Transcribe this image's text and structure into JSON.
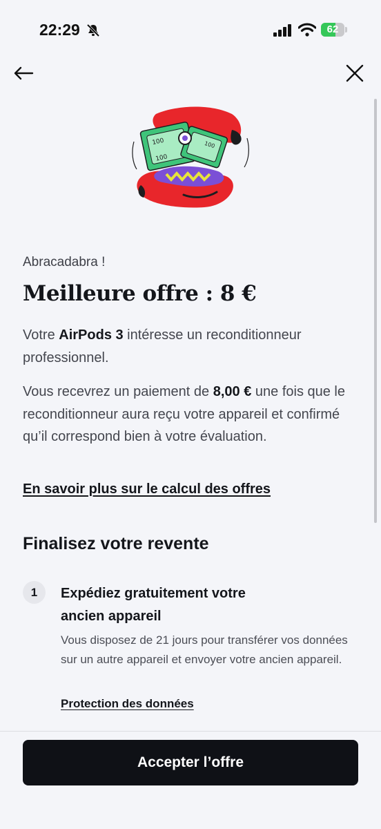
{
  "status_bar": {
    "time": "22:29",
    "battery_level": "62",
    "battery_fraction": 0.62,
    "icons": [
      "bell-slash-icon",
      "cellular-signal-icon",
      "wifi-icon",
      "battery-charging-icon"
    ]
  },
  "nav": {
    "back_icon": "arrow-left-icon",
    "close_icon": "close-icon"
  },
  "illustration": {
    "name": "hands-with-banknotes-illustration",
    "colors": {
      "red": "#e8262b",
      "green": "#3fc47a",
      "purple": "#7b4fd6",
      "yellow": "#e8e43a"
    }
  },
  "offer": {
    "kicker": "Abracadabra !",
    "title": "Meilleure offre : 8 €",
    "para1_prefix": "Votre ",
    "para1_product": "AirPods 3",
    "para1_suffix": " intéresse un reconditionneur professionnel.",
    "para2_prefix": "Vous recevrez un paiement de ",
    "para2_amount": "8,00 €",
    "para2_suffix": " une fois que le reconditionneur aura reçu votre appareil et confirmé qu’il correspond bien à votre évaluation.",
    "learn_more_link": "En savoir plus sur le calcul des offres"
  },
  "finalize": {
    "title": "Finalisez votre revente",
    "steps": [
      {
        "number": "1",
        "title": "Expédiez gratuitement votre ancien appareil",
        "description": "Vous disposez de 21 jours pour transférer vos données sur un autre appareil et envoyer votre ancien appareil.",
        "link": "Protection des données"
      }
    ]
  },
  "footer": {
    "accept_button": "Accepter l’offre"
  },
  "colors": {
    "background": "#f4f5f9",
    "button": "#0f1116",
    "battery_green": "#35c759"
  }
}
